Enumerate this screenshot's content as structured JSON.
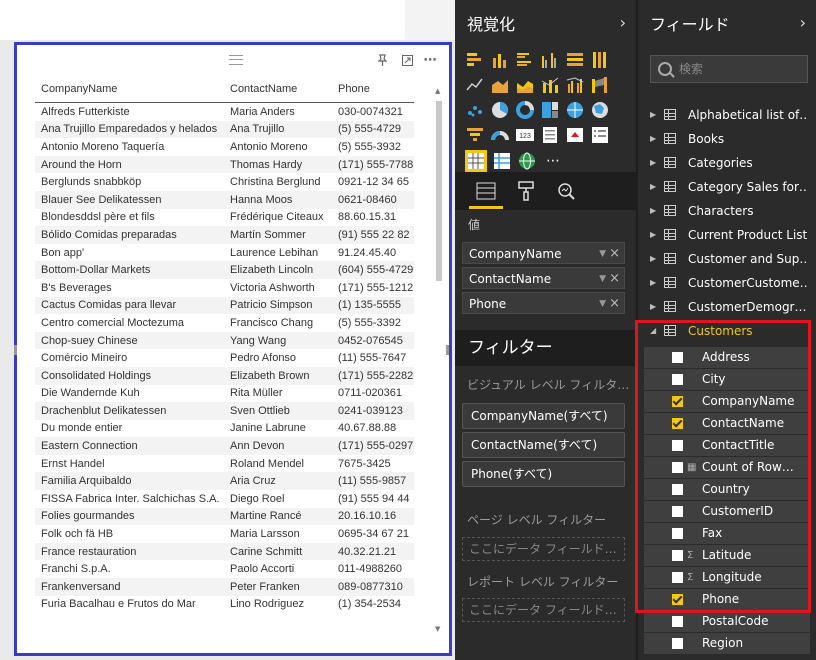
{
  "table": {
    "columns": [
      "CompanyName",
      "ContactName",
      "Phone"
    ],
    "rows": [
      [
        "Alfreds Futterkiste",
        "Maria Anders",
        "030-0074321"
      ],
      [
        "Ana Trujillo Emparedados y helados",
        "Ana Trujillo",
        "(5) 555-4729"
      ],
      [
        "Antonio Moreno Taquería",
        "Antonio Moreno",
        "(5) 555-3932"
      ],
      [
        "Around the Horn",
        "Thomas Hardy",
        "(171) 555-7788"
      ],
      [
        "Berglunds snabbköp",
        "Christina Berglund",
        "0921-12 34 65"
      ],
      [
        "Blauer See Delikatessen",
        "Hanna Moos",
        "0621-08460"
      ],
      [
        "Blondesddsl père et fils",
        "Frédérique Citeaux",
        "88.60.15.31"
      ],
      [
        "Bólido Comidas preparadas",
        "Martín Sommer",
        "(91) 555 22 82"
      ],
      [
        "Bon app'",
        "Laurence Lebihan",
        "91.24.45.40"
      ],
      [
        "Bottom-Dollar Markets",
        "Elizabeth Lincoln",
        "(604) 555-4729"
      ],
      [
        "B's Beverages",
        "Victoria Ashworth",
        "(171) 555-1212"
      ],
      [
        "Cactus Comidas para llevar",
        "Patricio Simpson",
        "(1) 135-5555"
      ],
      [
        "Centro comercial Moctezuma",
        "Francisco Chang",
        "(5) 555-3392"
      ],
      [
        "Chop-suey Chinese",
        "Yang Wang",
        "0452-076545"
      ],
      [
        "Comércio Mineiro",
        "Pedro Afonso",
        "(11) 555-7647"
      ],
      [
        "Consolidated Holdings",
        "Elizabeth Brown",
        "(171) 555-2282"
      ],
      [
        "Die Wandernde Kuh",
        "Rita Müller",
        "0711-020361"
      ],
      [
        "Drachenblut Delikatessen",
        "Sven Ottlieb",
        "0241-039123"
      ],
      [
        "Du monde entier",
        "Janine Labrune",
        "40.67.88.88"
      ],
      [
        "Eastern Connection",
        "Ann Devon",
        "(171) 555-0297"
      ],
      [
        "Ernst Handel",
        "Roland Mendel",
        "7675-3425"
      ],
      [
        "Familia Arquibaldo",
        "Aria Cruz",
        "(11) 555-9857"
      ],
      [
        "FISSA Fabrica Inter. Salchichas S.A.",
        "Diego Roel",
        "(91) 555 94 44"
      ],
      [
        "Folies gourmandes",
        "Martine Rancé",
        "20.16.10.16"
      ],
      [
        "Folk och fä HB",
        "Maria Larsson",
        "0695-34 67 21"
      ],
      [
        "France restauration",
        "Carine Schmitt",
        "40.32.21.21"
      ],
      [
        "Franchi S.p.A.",
        "Paolo Accorti",
        "011-4988260"
      ],
      [
        "Frankenversand",
        "Peter Franken",
        "089-0877310"
      ],
      [
        "Furia Bacalhau e Frutos do Mar",
        "Lino Rodriguez",
        "(1) 354-2534"
      ]
    ]
  },
  "viz_pane": {
    "title": "視覚化",
    "values_label": "値",
    "wells": [
      "CompanyName",
      "ContactName",
      "Phone"
    ],
    "filters_title": "フィルター",
    "visual_filters_label": "ビジュアル レベル フィルタ…",
    "filter_cards": [
      "CompanyName(すべて)",
      "ContactName(すべて)",
      "Phone(すべて)"
    ],
    "page_filters_label": "ページ レベル フィルター",
    "page_drop": "ここにデータ フィールド…",
    "report_filters_label": "レポート レベル フィルター",
    "report_drop": "ここにデータ フィールド…"
  },
  "fields_pane": {
    "title": "フィールド",
    "search_placeholder": "検索",
    "tables": [
      "Alphabetical list of…",
      "Books",
      "Categories",
      "Category Sales for…",
      "Characters",
      "Current Product List",
      "Customer and Sup…",
      "CustomerCustome…",
      "CustomerDemogr…"
    ],
    "expanded_table": "Customers",
    "fields": [
      {
        "name": "Address",
        "checked": false,
        "type": ""
      },
      {
        "name": "City",
        "checked": false,
        "type": ""
      },
      {
        "name": "CompanyName",
        "checked": true,
        "type": ""
      },
      {
        "name": "ContactName",
        "checked": true,
        "type": ""
      },
      {
        "name": "ContactTitle",
        "checked": false,
        "type": ""
      },
      {
        "name": "Count of Row…",
        "checked": false,
        "type": "calc"
      },
      {
        "name": "Country",
        "checked": false,
        "type": ""
      },
      {
        "name": "CustomerID",
        "checked": false,
        "type": ""
      },
      {
        "name": "Fax",
        "checked": false,
        "type": ""
      },
      {
        "name": "Latitude",
        "checked": false,
        "type": "sum"
      },
      {
        "name": "Longitude",
        "checked": false,
        "type": "sum"
      },
      {
        "name": "Phone",
        "checked": true,
        "type": ""
      },
      {
        "name": "PostalCode",
        "checked": false,
        "type": ""
      },
      {
        "name": "Region",
        "checked": false,
        "type": ""
      }
    ],
    "colors": {
      "accent": "#f2c811",
      "highlight": "#e0141e"
    }
  },
  "icons": {
    "more": "⋯",
    "pin": "📌",
    "focus": "⤢",
    "chevron": "›",
    "sum": "Σ",
    "calc": "▦"
  }
}
